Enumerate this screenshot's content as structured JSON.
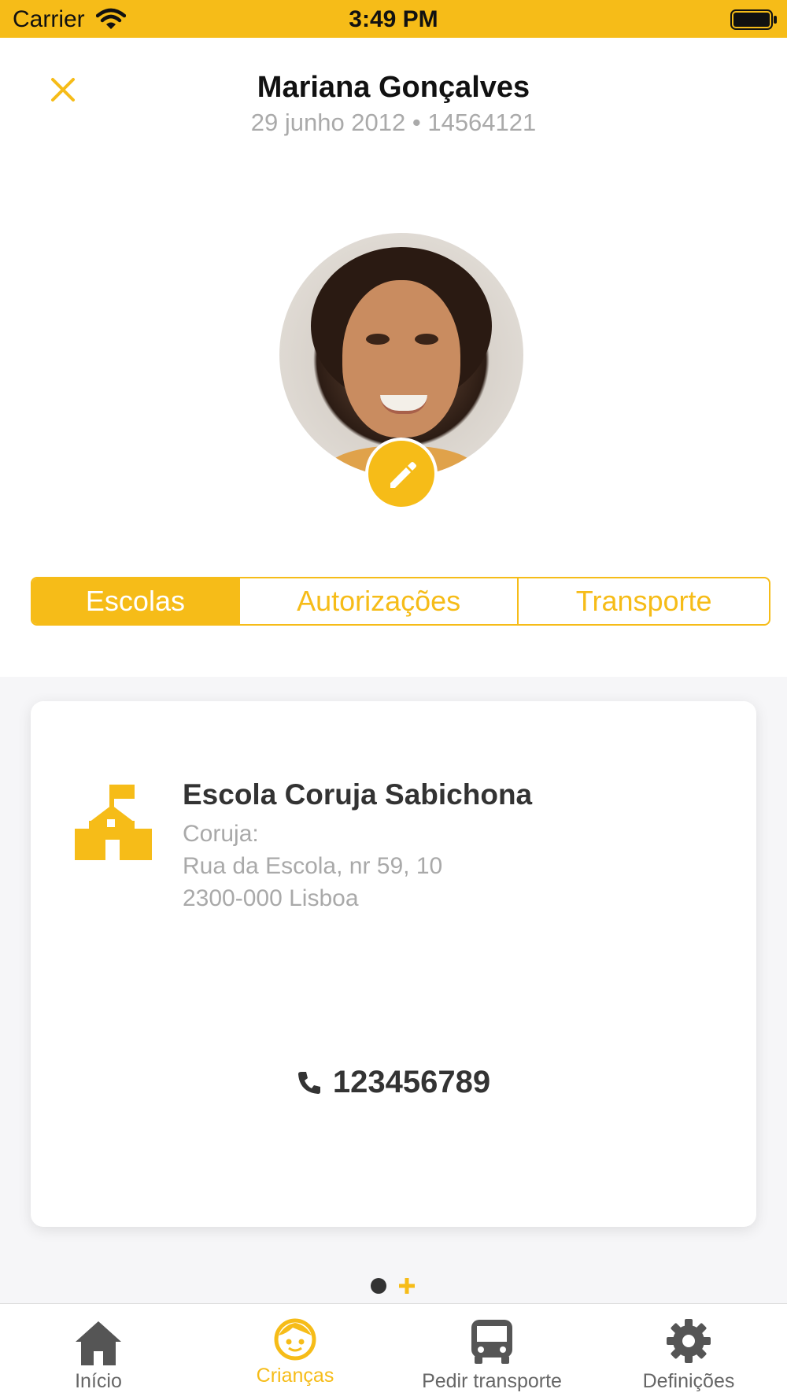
{
  "colors": {
    "accent": "#F6BC18",
    "text_dark": "#333333",
    "text_muted": "#a9a9a9"
  },
  "status_bar": {
    "carrier": "Carrier",
    "time": "3:49 PM"
  },
  "header": {
    "close_icon": "close-icon",
    "name": "Mariana Gonçalves",
    "subtitle": "29 junho 2012 • 14564121"
  },
  "profile": {
    "edit_icon": "pencil-icon"
  },
  "segments": [
    {
      "label": "Escolas",
      "selected": true
    },
    {
      "label": "Autorizações",
      "selected": false
    },
    {
      "label": "Transporte",
      "selected": false
    }
  ],
  "school": {
    "icon": "school-icon",
    "name": "Escola Coruja Sabichona",
    "address_lines": [
      "Coruja:",
      "Rua da Escola, nr 59, 10",
      "2300-000 Lisboa"
    ],
    "phone_icon": "phone-icon",
    "phone": "123456789"
  },
  "pager": {
    "pages": 1,
    "current": 1,
    "add_icon": "plus-icon"
  },
  "tab_bar": [
    {
      "label": "Início",
      "icon": "home-icon",
      "active": false
    },
    {
      "label": "Crianças",
      "icon": "child-face-icon",
      "active": true
    },
    {
      "label": "Pedir transporte",
      "icon": "bus-icon",
      "active": false
    },
    {
      "label": "Definições",
      "icon": "gear-icon",
      "active": false
    }
  ]
}
